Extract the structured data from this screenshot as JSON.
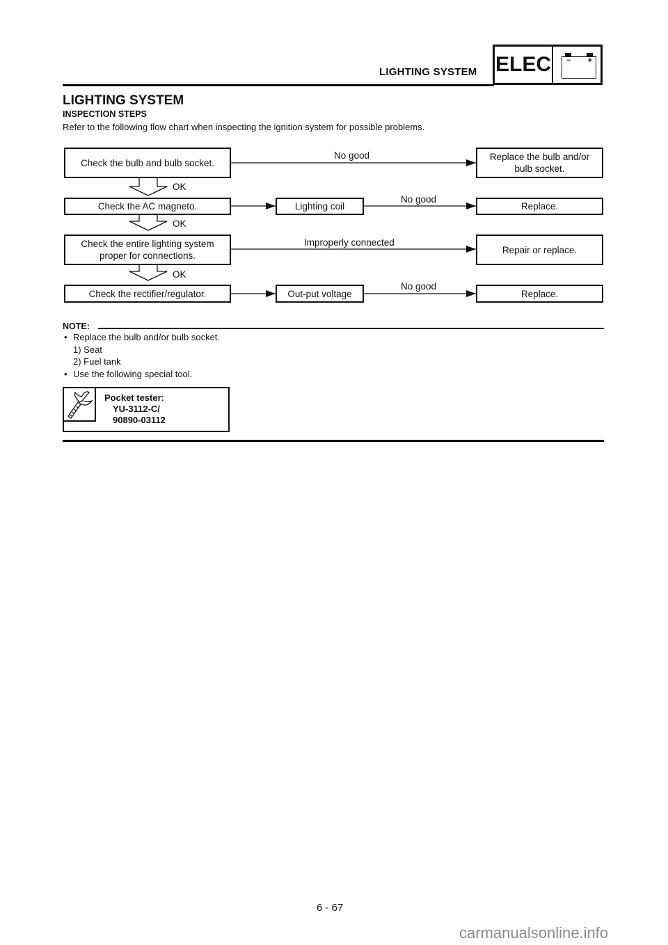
{
  "header": {
    "section_title": "LIGHTING SYSTEM",
    "badge": "ELEC",
    "battery_icon": {
      "minus": "−",
      "plus": "+"
    }
  },
  "title": "LIGHTING SYSTEM",
  "subtitle": "INSPECTION STEPS",
  "intro": "Refer to the following flow chart when inspecting the ignition system for possible problems.",
  "flow": {
    "steps": [
      {
        "check": "Check the bulb and bulb socket.",
        "branch_label": "No good",
        "result": "Replace the bulb and/or bulb socket."
      },
      {
        "check": "Check the AC magneto.",
        "intermediate": "Lighting coil",
        "branch_label": "No good",
        "result": "Replace."
      },
      {
        "check": "Check the entire lighting system proper for connections.",
        "branch_label": "Improperly connected",
        "result": "Repair or replace."
      },
      {
        "check": "Check the rectifier/regulator.",
        "intermediate": "Out-put voltage",
        "branch_label": "No good",
        "result": "Replace."
      }
    ],
    "ok_label": "OK"
  },
  "note": {
    "label": "NOTE:",
    "items": [
      "Replace the bulb and/or bulb socket.",
      "1) Seat",
      "2) Fuel tank",
      "Use the following special tool."
    ],
    "bullet": "•"
  },
  "tool": {
    "name": "Pocket tester:",
    "part1": "YU-3112-C/",
    "part2": "90890-03112"
  },
  "footer": {
    "page": "6 - 67",
    "watermark": "carmanualsonline.info"
  }
}
